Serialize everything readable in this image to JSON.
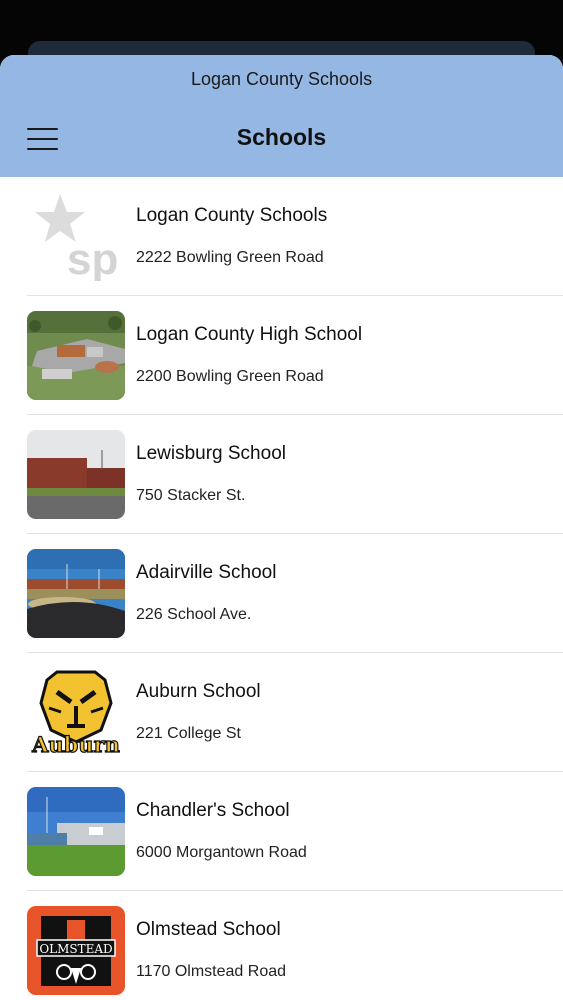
{
  "header": {
    "app_title": "Logan County Schools",
    "page_title": "Schools",
    "background": "#94b7e3"
  },
  "schools": [
    {
      "name": "Logan County Schools",
      "address": "2222 Bowling Green Road",
      "icon": "sp-logo-icon",
      "logo_text": "sp"
    },
    {
      "name": "Logan County High School",
      "address": "2200 Bowling Green Road",
      "icon": "aerial-campus-photo"
    },
    {
      "name": "Lewisburg School",
      "address": "750 Stacker St.",
      "icon": "brick-building-photo"
    },
    {
      "name": "Adairville School",
      "address": "226 School Ave.",
      "icon": "school-driveway-photo"
    },
    {
      "name": "Auburn School",
      "address": "221 College St",
      "icon": "tiger-logo-icon",
      "logo_text": "Auburn"
    },
    {
      "name": "Chandler's School",
      "address": "6000 Morgantown Road",
      "icon": "modern-building-photo"
    },
    {
      "name": "Olmstead School",
      "address": "1170 Olmstead Road",
      "icon": "ram-logo-icon",
      "logo_text": "OLMSTEAD"
    }
  ]
}
